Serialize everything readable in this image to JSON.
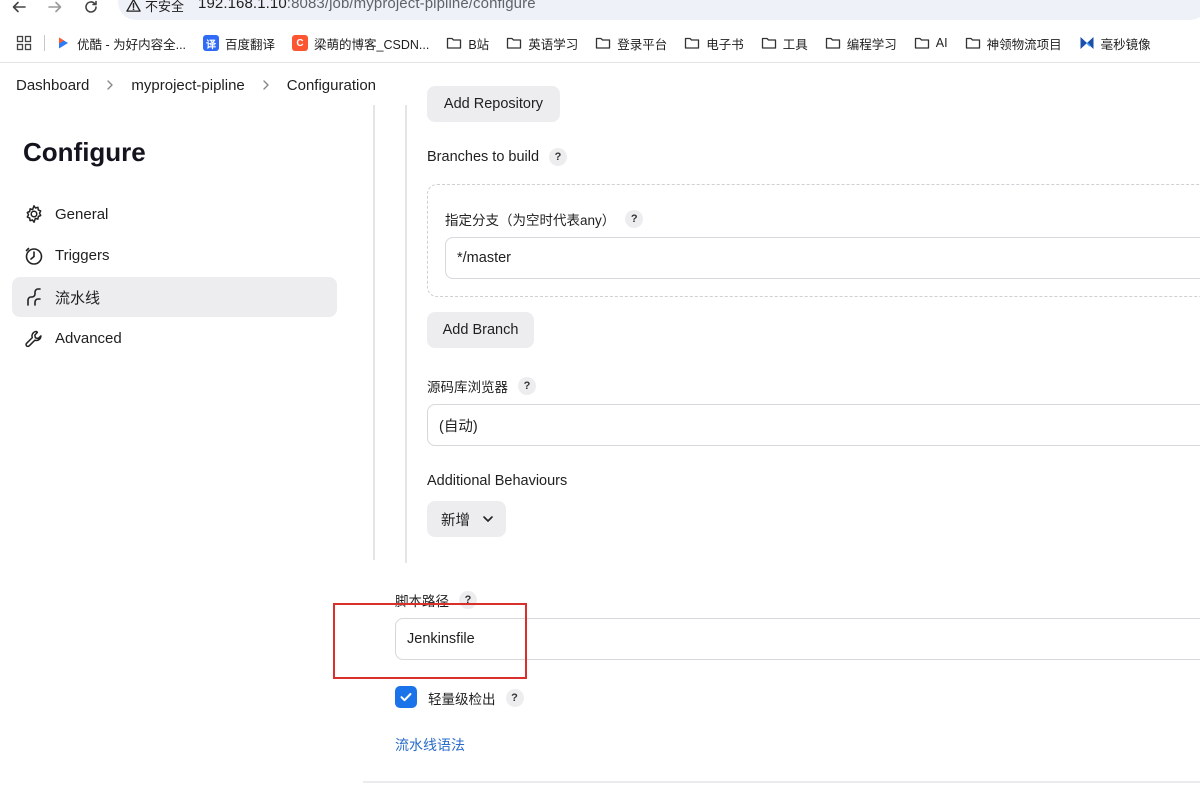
{
  "browser": {
    "security_warning": "不安全",
    "url_host": "192.168.1.10",
    "url_rest": ":8083/job/myproject-pipline/configure",
    "bookmarks": [
      {
        "label": "优酷 - 为好内容全...",
        "icon": "youku-icon",
        "color": "#2f7bf6"
      },
      {
        "label": "百度翻译",
        "icon": "baidu-translate-icon",
        "color": "#2f6bf6",
        "glyph": "译"
      },
      {
        "label": "梁萌的博客_CSDN...",
        "icon": "csdn-icon",
        "color": "#fc5531",
        "glyph": "C"
      },
      {
        "label": "B站",
        "icon": "folder-icon"
      },
      {
        "label": "英语学习",
        "icon": "folder-icon"
      },
      {
        "label": "登录平台",
        "icon": "folder-icon"
      },
      {
        "label": "电子书",
        "icon": "folder-icon"
      },
      {
        "label": "工具",
        "icon": "folder-icon"
      },
      {
        "label": "编程学习",
        "icon": "folder-icon"
      },
      {
        "label": "AI",
        "icon": "folder-icon"
      },
      {
        "label": "神领物流项目",
        "icon": "folder-icon"
      },
      {
        "label": "毫秒镜像",
        "icon": "haomiao-icon",
        "color": "#1b4fa8"
      }
    ]
  },
  "breadcrumb": [
    "Dashboard",
    "myproject-pipline",
    "Configuration"
  ],
  "sidebar": {
    "title": "Configure",
    "items": [
      {
        "label": "General",
        "icon": "gear-icon",
        "active": false
      },
      {
        "label": "Triggers",
        "icon": "clock-icon",
        "active": false
      },
      {
        "label": "流水线",
        "icon": "pipeline-icon",
        "active": true
      },
      {
        "label": "Advanced",
        "icon": "wrench-icon",
        "active": false
      }
    ]
  },
  "scm": {
    "partial_button": "Add Repository",
    "branches_label": "Branches to build",
    "branch_specifier_label": "指定分支（为空时代表any）",
    "branch_specifier_value": "*/master",
    "add_branch_label": "Add Branch",
    "repo_browser_label": "源码库浏览器",
    "repo_browser_value": "(自动)",
    "additional_behaviours_label": "Additional Behaviours",
    "add_button_label": "新增"
  },
  "script": {
    "path_label": "脚本路径",
    "path_value": "Jenkinsfile",
    "lightweight_checkout_label": "轻量级检出",
    "lightweight_checkout_checked": true,
    "syntax_link": "流水线语法"
  },
  "help_glyph": "?",
  "colors": {
    "accent": "#1a73e8",
    "link": "#2a6cc9",
    "highlight_box": "#d9302c",
    "active_nav_bg": "#ededf0"
  }
}
